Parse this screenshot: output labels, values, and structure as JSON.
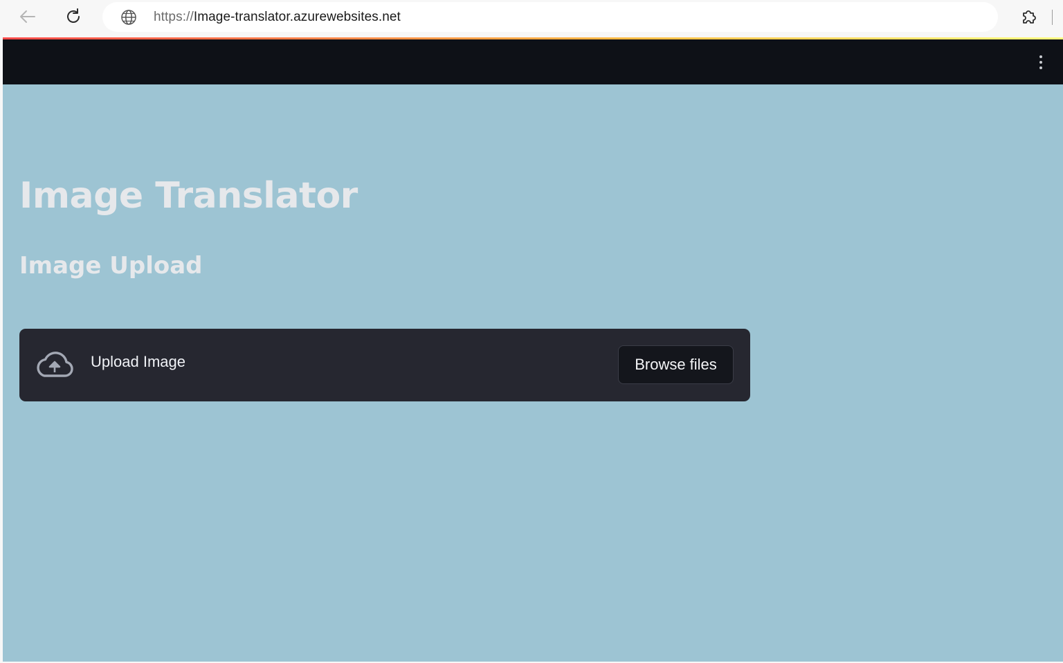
{
  "browser": {
    "url_scheme": "https://",
    "url_host": "Image-translator.azurewebsites.net",
    "icons": [
      "back-arrow-icon",
      "reload-icon",
      "globe-icon",
      "extensions-icon"
    ]
  },
  "app": {
    "header_menu_icon": "kebab-menu-icon",
    "title": "Image Translator",
    "subheader": "Image Upload",
    "uploader": {
      "label": "Upload Image",
      "icon": "cloud-upload-icon",
      "button_label": "Browse files"
    },
    "colors": {
      "page_background": "#9dc4d3",
      "header_background": "#0e1117",
      "uploader_background": "#262730",
      "heading_text": "#e6e8eb"
    }
  }
}
